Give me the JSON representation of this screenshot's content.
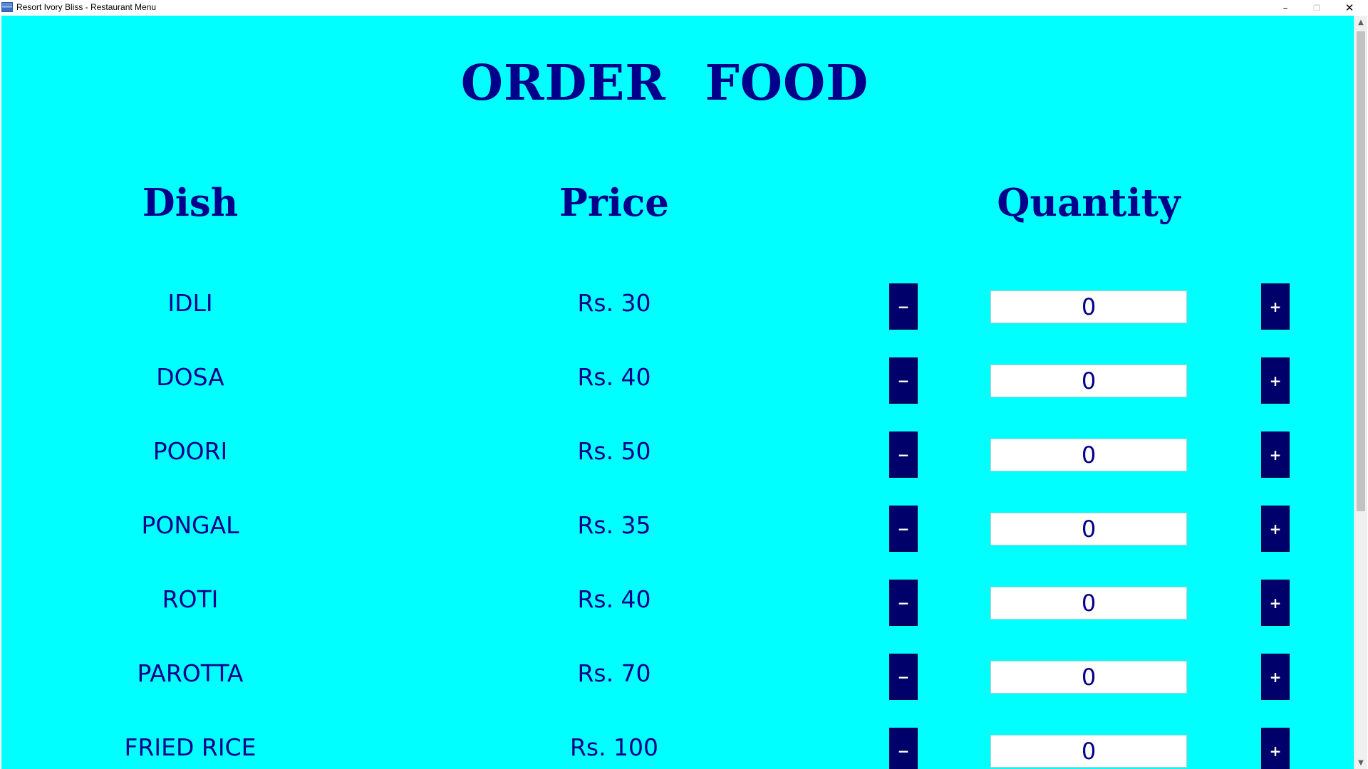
{
  "window": {
    "title": "Resort Ivory Bliss - Restaurant Menu",
    "controls": {
      "minimize": "–",
      "maximize": "❐",
      "close": "✕"
    }
  },
  "page": {
    "title": "ORDER FOOD",
    "headers": {
      "dish": "Dish",
      "price": "Price",
      "quantity": "Quantity"
    }
  },
  "menu": [
    {
      "dish": "IDLI",
      "price": "Rs. 30",
      "quantity": "0"
    },
    {
      "dish": "DOSA",
      "price": "Rs. 40",
      "quantity": "0"
    },
    {
      "dish": "POORI",
      "price": "Rs. 50",
      "quantity": "0"
    },
    {
      "dish": "PONGAL",
      "price": "Rs. 35",
      "quantity": "0"
    },
    {
      "dish": "ROTI",
      "price": "Rs. 40",
      "quantity": "0"
    },
    {
      "dish": "PAROTTA",
      "price": "Rs. 70",
      "quantity": "0"
    },
    {
      "dish": "FRIED RICE",
      "price": "Rs. 100",
      "quantity": "0"
    }
  ],
  "buttons": {
    "minus": "−",
    "plus": "+"
  },
  "scrollbar": {
    "up": "▲",
    "down": "▼"
  },
  "colors": {
    "background": "#00ffff",
    "text": "#00008b",
    "button": "#00006b",
    "button_text": "#ffffff"
  }
}
